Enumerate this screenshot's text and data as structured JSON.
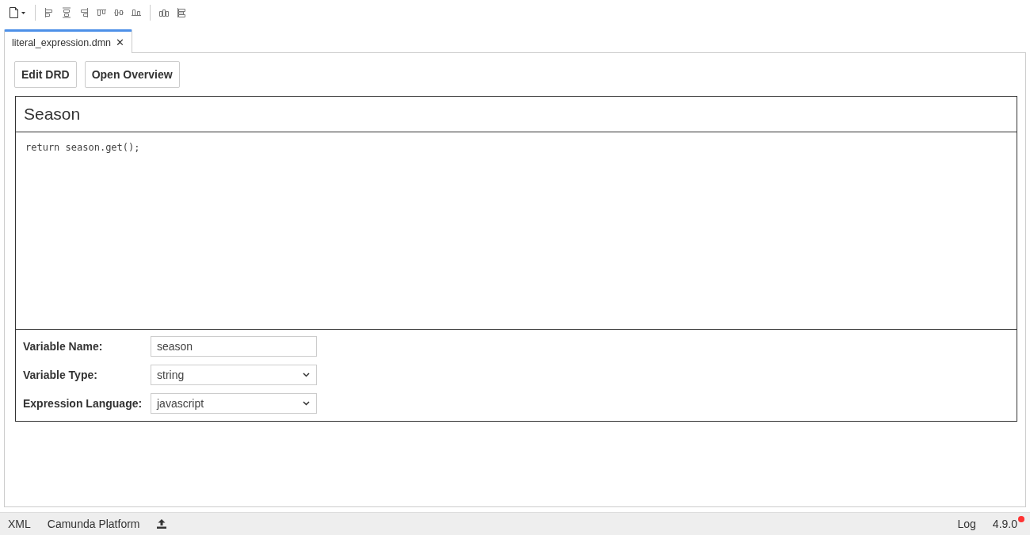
{
  "tabs": [
    {
      "label": "literal_expression.dmn",
      "selected": true,
      "close": "✕"
    }
  ],
  "buttons": [
    "Edit DRD",
    "Open Overview"
  ],
  "expression": {
    "title": "Season",
    "code": "return season.get();",
    "fields": [
      {
        "kind": "input",
        "label": "Variable Name:",
        "value": "season"
      },
      {
        "kind": "select",
        "label": "Variable Type:",
        "value": "string"
      },
      {
        "kind": "select",
        "label": "Expression Language:",
        "value": "javascript"
      }
    ]
  },
  "status_bar": {
    "left": [
      "XML",
      "Camunda Platform"
    ],
    "log": "Log",
    "version": "4.9.0",
    "update_notice": true
  }
}
